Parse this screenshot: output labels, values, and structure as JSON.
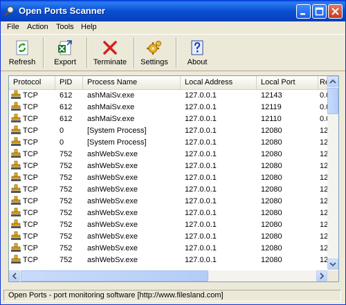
{
  "window": {
    "title": "Open Ports Scanner"
  },
  "menu": [
    "File",
    "Action",
    "Tools",
    "Help"
  ],
  "toolbar": {
    "refresh": "Refresh",
    "export": "Export",
    "terminate": "Terminate",
    "settings": "Settings",
    "about": "About"
  },
  "columns": [
    "Protocol",
    "PID",
    "Process Name",
    "Local Address",
    "Local Port",
    "Re"
  ],
  "rows": [
    [
      "TCP",
      "612",
      "ashMaiSv.exe",
      "127.0.0.1",
      "12143",
      "0.0"
    ],
    [
      "TCP",
      "612",
      "ashMaiSv.exe",
      "127.0.0.1",
      "12119",
      "0.0"
    ],
    [
      "TCP",
      "612",
      "ashMaiSv.exe",
      "127.0.0.1",
      "12110",
      "0.0"
    ],
    [
      "TCP",
      "0",
      "[System Process]",
      "127.0.0.1",
      "12080",
      "12"
    ],
    [
      "TCP",
      "0",
      "[System Process]",
      "127.0.0.1",
      "12080",
      "12"
    ],
    [
      "TCP",
      "752",
      "ashWebSv.exe",
      "127.0.0.1",
      "12080",
      "12"
    ],
    [
      "TCP",
      "752",
      "ashWebSv.exe",
      "127.0.0.1",
      "12080",
      "12"
    ],
    [
      "TCP",
      "752",
      "ashWebSv.exe",
      "127.0.0.1",
      "12080",
      "12"
    ],
    [
      "TCP",
      "752",
      "ashWebSv.exe",
      "127.0.0.1",
      "12080",
      "12"
    ],
    [
      "TCP",
      "752",
      "ashWebSv.exe",
      "127.0.0.1",
      "12080",
      "12"
    ],
    [
      "TCP",
      "752",
      "ashWebSv.exe",
      "127.0.0.1",
      "12080",
      "12"
    ],
    [
      "TCP",
      "752",
      "ashWebSv.exe",
      "127.0.0.1",
      "12080",
      "12"
    ],
    [
      "TCP",
      "752",
      "ashWebSv.exe",
      "127.0.0.1",
      "12080",
      "12"
    ],
    [
      "TCP",
      "752",
      "ashWebSv.exe",
      "127.0.0.1",
      "12080",
      "12"
    ],
    [
      "TCP",
      "752",
      "ashWebSv.exe",
      "127.0.0.1",
      "12080",
      "12"
    ]
  ],
  "status": {
    "text": "Open Ports - port monitoring software  [http://www.filesland.com]"
  }
}
